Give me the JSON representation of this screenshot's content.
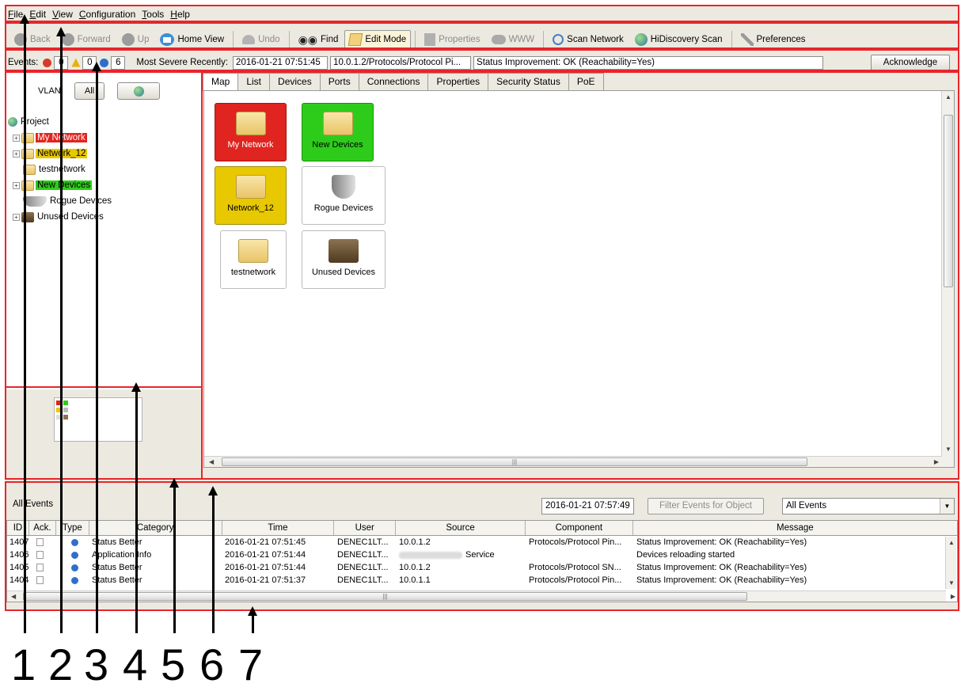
{
  "menu": [
    "File",
    "Edit",
    "View",
    "Configuration",
    "Tools",
    "Help"
  ],
  "toolbar": {
    "back": "Back",
    "forward": "Forward",
    "up": "Up",
    "home": "Home View",
    "undo": "Undo",
    "find": "Find",
    "edit_mode": "Edit Mode",
    "properties": "Properties",
    "www": "WWW",
    "scan_network": "Scan Network",
    "hidiscovery": "HiDiscovery Scan",
    "preferences": "Preferences"
  },
  "events_bar": {
    "label": "Events:",
    "errors": "0",
    "warnings": "0",
    "infos": "6",
    "most_severe_label": "Most Severe Recently:",
    "most_severe_time": "2016-01-21 07:51:45",
    "most_severe_source": "10.0.1.2/Protocols/Protocol Pi...",
    "most_severe_message": "Status Improvement: OK (Reachability=Yes)",
    "acknowledge": "Acknowledge"
  },
  "left_panel": {
    "vlan_label": "VLAN:",
    "vlan_all": "All",
    "tree": [
      {
        "label": "Project",
        "color": "#ffffff"
      },
      {
        "label": "My Network",
        "color": "#e0241f"
      },
      {
        "label": "Network_12",
        "color": "#e8c800"
      },
      {
        "label": "testnetwork",
        "color": "#ffffff"
      },
      {
        "label": "New Devices",
        "color": "#2ecc1a"
      },
      {
        "label": "Rogue Devices",
        "color": "#ffffff"
      },
      {
        "label": "Unused Devices",
        "color": "#ffffff"
      }
    ]
  },
  "tabs": [
    "Map",
    "List",
    "Devices",
    "Ports",
    "Connections",
    "Properties",
    "Security Status",
    "PoE"
  ],
  "map_tiles": [
    {
      "label": "My Network",
      "color": "#e0241f"
    },
    {
      "label": "New Devices",
      "color": "#2ecc1a"
    },
    {
      "label": "Network_12",
      "color": "#e8c800"
    },
    {
      "label": "Rogue Devices",
      "color": "#ffffff"
    },
    {
      "label": "testnetwork",
      "color": "#ffffff"
    },
    {
      "label": "Unused Devices",
      "color": "#ffffff"
    }
  ],
  "events_panel": {
    "title": "All Events",
    "timestamp": "2016-01-21 07:57:49",
    "filter_button": "Filter Events for Object",
    "filter_select": "All Events",
    "columns": [
      "ID",
      "Ack.",
      "Type",
      "Category",
      "Time",
      "User",
      "Source",
      "Component",
      "Message"
    ],
    "rows": [
      {
        "id": "1407",
        "category": "Status Better",
        "time": "2016-01-21 07:51:45",
        "user": "DENEC1LT...",
        "source": "10.0.1.2",
        "component": "Protocols/Protocol Pin...",
        "message": "Status Improvement: OK (Reachability=Yes)"
      },
      {
        "id": "1406",
        "category": "Application Info",
        "time": "2016-01-21 07:51:44",
        "user": "DENEC1LT...",
        "source": "Service",
        "component": "",
        "message": "Devices reloading started"
      },
      {
        "id": "1405",
        "category": "Status Better",
        "time": "2016-01-21 07:51:44",
        "user": "DENEC1LT...",
        "source": "10.0.1.2",
        "component": "Protocols/Protocol SN...",
        "message": "Status Improvement: OK (Reachability=Yes)"
      },
      {
        "id": "1404",
        "category": "Status Better",
        "time": "2016-01-21 07:51:37",
        "user": "DENEC1LT...",
        "source": "10.0.1.1",
        "component": "Protocols/Protocol Pin...",
        "message": "Status Improvement: OK (Reachability=Yes)"
      }
    ]
  },
  "callouts": [
    "1",
    "2",
    "3",
    "4",
    "5",
    "6",
    "7"
  ],
  "colors": {
    "highlight": "#e8252b",
    "accent": "#3c8fd6"
  }
}
